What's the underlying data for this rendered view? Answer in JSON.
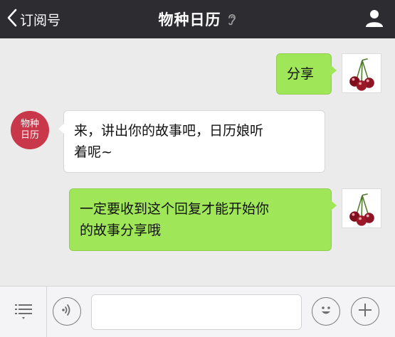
{
  "nav": {
    "back_label": "订阅号",
    "title": "物种日历",
    "icons": {
      "back": "chevron-left-icon",
      "ear": "ear-icon",
      "profile": "person-icon"
    }
  },
  "messages": [
    {
      "side": "out",
      "text": "分享",
      "avatar": "cherries"
    },
    {
      "side": "in",
      "lines": [
        "来，讲出你的故事吧，日历娘听",
        "着呢~"
      ],
      "avatar": "brand"
    },
    {
      "side": "out",
      "lines": [
        "一定要收到这个回复才能开始你",
        "的故事分享哦"
      ],
      "avatar": "cherries"
    }
  ],
  "brand_avatar": {
    "line1": "物种",
    "line2": "日历",
    "color": "#c8374a"
  },
  "input": {
    "value": "",
    "placeholder": ""
  },
  "colors": {
    "nav_bg": "#2d2d31",
    "chat_bg": "#ebebeb",
    "out_bubble": "#9fe658",
    "in_bubble": "#ffffff",
    "brand": "#c8374a"
  },
  "toolbar": {
    "icons": [
      "menu-list-icon",
      "voice-icon",
      "emoji-icon",
      "plus-icon"
    ]
  }
}
